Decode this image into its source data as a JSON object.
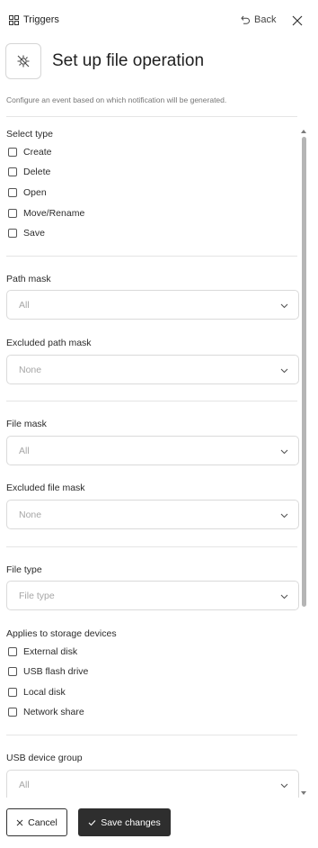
{
  "header": {
    "breadcrumb": "Triggers",
    "back_label": "Back",
    "title": "Set up file operation",
    "description": "Configure an event based on which notification will be generated."
  },
  "select_type": {
    "label": "Select type",
    "options": [
      "Create",
      "Delete",
      "Open",
      "Move/Rename",
      "Save"
    ]
  },
  "path_mask": {
    "label": "Path mask",
    "placeholder": "All"
  },
  "excluded_path_mask": {
    "label": "Excluded path mask",
    "placeholder": "None"
  },
  "file_mask": {
    "label": "File mask",
    "placeholder": "All"
  },
  "excluded_file_mask": {
    "label": "Excluded file mask",
    "placeholder": "None"
  },
  "file_type": {
    "label": "File type",
    "placeholder": "File type"
  },
  "storage_devices": {
    "label": "Applies to storage devices",
    "options": [
      "External disk",
      "USB flash drive",
      "Local disk",
      "Network share"
    ]
  },
  "usb_device_group": {
    "label": "USB device group",
    "placeholder": "All"
  },
  "footer": {
    "cancel_label": "Cancel",
    "save_label": "Save changes"
  }
}
